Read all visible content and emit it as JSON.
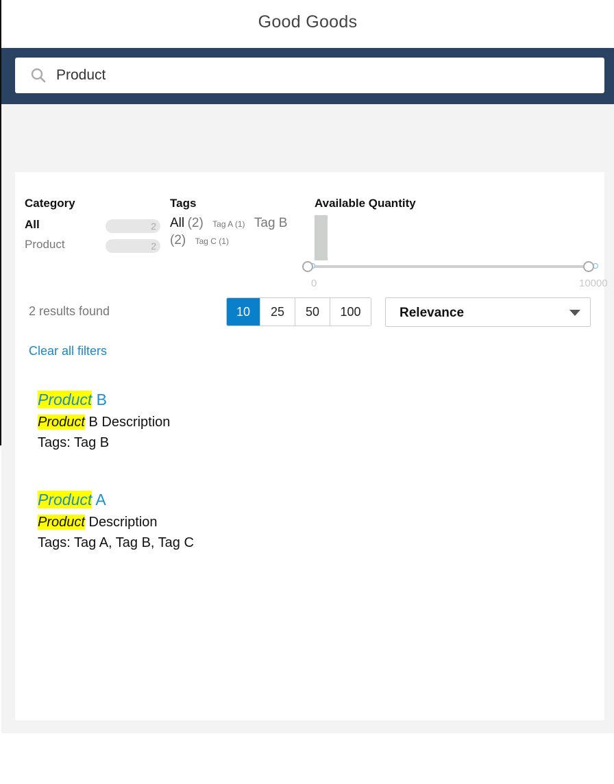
{
  "app": {
    "title": "Good Goods"
  },
  "search": {
    "value": "Product"
  },
  "facets": {
    "category": {
      "title": "Category",
      "items": [
        {
          "label": "All",
          "count": "2",
          "selected": true
        },
        {
          "label": "Product",
          "count": "2",
          "selected": false
        }
      ]
    },
    "tags": {
      "title": "Tags",
      "all_label": "All",
      "all_count": "(2)",
      "items": [
        {
          "label": "Tag A",
          "count": "(1)"
        },
        {
          "label": "Tag B",
          "count": "(2)"
        },
        {
          "label": "Tag C",
          "count": "(1)"
        }
      ]
    },
    "quantity": {
      "title": "Available Quantity",
      "min_label": "0",
      "max_label": "10000",
      "range": [
        0,
        10000
      ]
    }
  },
  "results_info": {
    "count_text": "2 results found"
  },
  "page_sizes": [
    "10",
    "25",
    "50",
    "100"
  ],
  "page_size_selected": "10",
  "sort": {
    "selected": "Relevance"
  },
  "clear_filters": "Clear all filters",
  "results": [
    {
      "title_highlight": "Product",
      "title_rest": " B",
      "desc_highlight": "Product",
      "desc_rest": " B Description",
      "tags_text": "Tags: Tag B"
    },
    {
      "title_highlight": "Product",
      "title_rest": " A",
      "desc_highlight": "Product",
      "desc_rest": " Description",
      "tags_text": "Tags: Tag A, Tag B, Tag C"
    }
  ],
  "colors": {
    "header_bar": "#2a4363",
    "accent": "#0a7fca",
    "link": "#1888c8",
    "highlight": "#ffff00"
  }
}
